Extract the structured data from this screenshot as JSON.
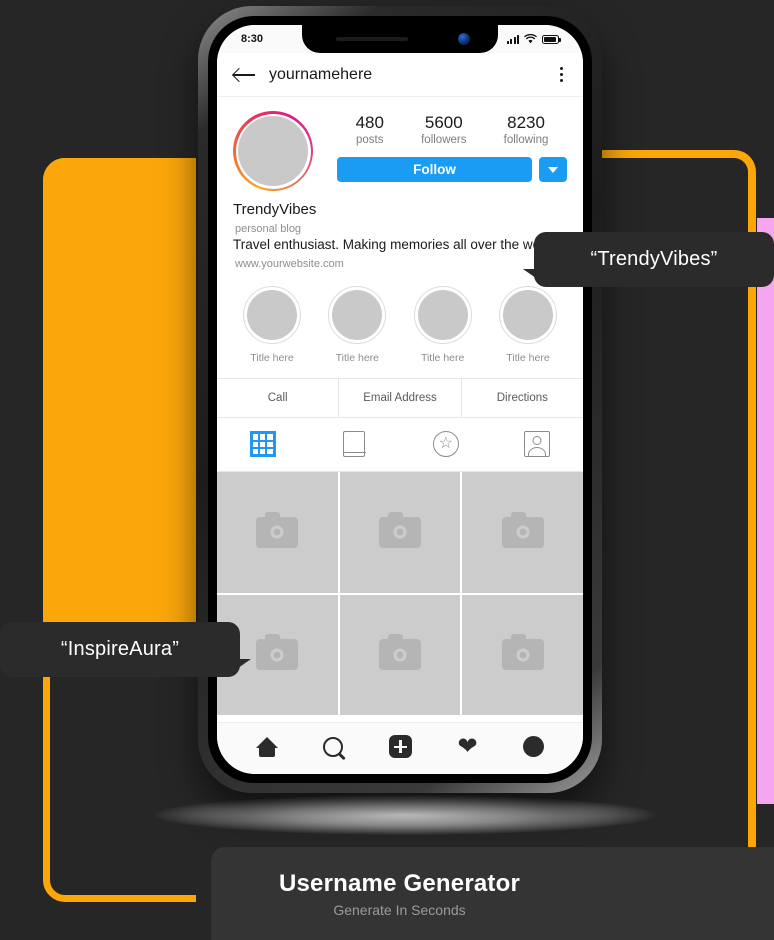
{
  "theme": {
    "background": "#262626",
    "accent_orange": "#FBA70A",
    "accent_pink": "#F6A6F0",
    "instagram_blue": "#1A9CF5",
    "banner_bg": "#343434",
    "bubble_bg": "#2B2B2B"
  },
  "phone": {
    "status_bar": {
      "time": "8:30",
      "icons": [
        "signal-icon",
        "wifi-icon",
        "battery-icon"
      ]
    },
    "app_header": {
      "back_icon": "back-arrow-icon",
      "title": "yournamehere",
      "menu_icon": "kebab-menu-icon"
    },
    "profile": {
      "avatar_alt": "profile-avatar-placeholder",
      "stats": [
        {
          "num": "480",
          "label": "posts"
        },
        {
          "num": "5600",
          "label": "followers"
        },
        {
          "num": "8230",
          "label": "following"
        }
      ],
      "follow_label": "Follow",
      "dropdown_icon": "caret-down-icon",
      "name": "TrendyVibes",
      "category": "personal blog",
      "description": "Travel enthusiast. Making memories all over the world.",
      "website": "www.yourwebsite.com"
    },
    "highlights": [
      {
        "caption": "Title here"
      },
      {
        "caption": "Title here"
      },
      {
        "caption": "Title here"
      },
      {
        "caption": "Title here"
      }
    ],
    "contact_buttons": [
      "Call",
      "Email Address",
      "Directions"
    ],
    "tabs": [
      {
        "icon": "grid-icon",
        "active": true
      },
      {
        "icon": "reels-icon",
        "active": false
      },
      {
        "icon": "star-circle-icon",
        "active": false
      },
      {
        "icon": "tagged-person-icon",
        "active": false
      }
    ],
    "photo_grid": {
      "rows": 2,
      "columns": 3,
      "placeholder_icon": "camera-icon"
    },
    "bottom_nav": [
      {
        "icon": "home-icon"
      },
      {
        "icon": "search-icon"
      },
      {
        "icon": "add-post-icon"
      },
      {
        "icon": "heart-icon"
      },
      {
        "icon": "profile-avatar-icon"
      }
    ]
  },
  "callouts": {
    "right": "“TrendyVibes”",
    "left": "“InspireAura”"
  },
  "banner": {
    "title": "Username Generator",
    "subtitle": "Generate In Seconds"
  }
}
